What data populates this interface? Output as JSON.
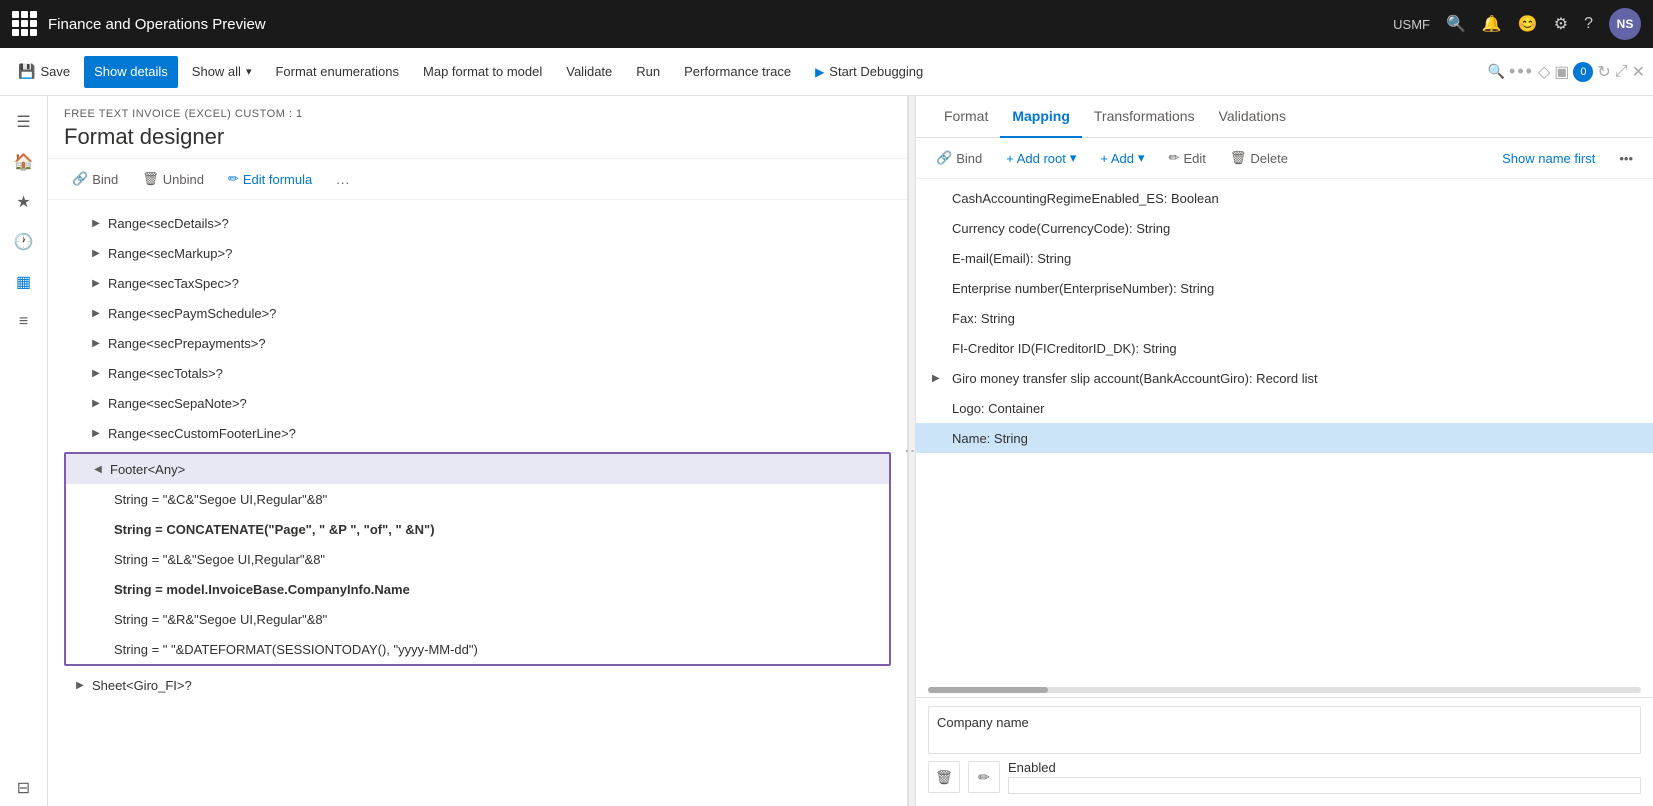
{
  "app": {
    "title": "Finance and Operations Preview",
    "user_region": "USMF",
    "avatar_initials": "NS"
  },
  "toolbar": {
    "save_label": "Save",
    "show_details_label": "Show details",
    "show_all_label": "Show all",
    "format_enumerations_label": "Format enumerations",
    "map_format_to_model_label": "Map format to model",
    "validate_label": "Validate",
    "run_label": "Run",
    "performance_trace_label": "Performance trace",
    "start_debugging_label": "Start Debugging"
  },
  "left_panel": {
    "breadcrumb": "FREE TEXT INVOICE (EXCEL) CUSTOM : 1",
    "page_title": "Format designer",
    "bind_label": "Bind",
    "unbind_label": "Unbind",
    "edit_formula_label": "Edit formula",
    "more_label": "...",
    "tree_items": [
      {
        "id": "range-secdetails",
        "label": "Range<secDetails>?",
        "indent": 1,
        "expanded": false
      },
      {
        "id": "range-secmarkup",
        "label": "Range<secMarkup>?",
        "indent": 1,
        "expanded": false
      },
      {
        "id": "range-sectaxspec",
        "label": "Range<secTaxSpec>?",
        "indent": 1,
        "expanded": false
      },
      {
        "id": "range-secpaymschedule",
        "label": "Range<secPaymSchedule>?",
        "indent": 1,
        "expanded": false
      },
      {
        "id": "range-secprepayments",
        "label": "Range<secPrepayments>?",
        "indent": 1,
        "expanded": false
      },
      {
        "id": "range-sectotals",
        "label": "Range<secTotals>?",
        "indent": 1,
        "expanded": false
      },
      {
        "id": "range-secsepanote",
        "label": "Range<secSepaNote>?",
        "indent": 1,
        "expanded": false
      },
      {
        "id": "range-seccustomfooterline",
        "label": "Range<secCustomFooterLine>?",
        "indent": 1,
        "expanded": false
      }
    ],
    "footer_group": {
      "header": "Footer<Any>",
      "items": [
        {
          "id": "string1",
          "label": "String = \"&C&\"Segoe UI,Regular\"&8\"",
          "bold": false
        },
        {
          "id": "string2",
          "label": "String = CONCATENATE(\"Page\", \" &P \", \"of\", \" &N\")",
          "bold": true
        },
        {
          "id": "string3",
          "label": "String = \"&L&\"Segoe UI,Regular\"&8\"",
          "bold": false
        },
        {
          "id": "string4",
          "label": "String = model.InvoiceBase.CompanyInfo.Name",
          "bold": true
        },
        {
          "id": "string5",
          "label": "String = \"&R&\"Segoe UI,Regular\"&8\"",
          "bold": false
        },
        {
          "id": "string6",
          "label": "String = \" \"&DATEFORMAT(SESSIONTODAY(), \"yyyy-MM-dd\")",
          "bold": false
        }
      ]
    },
    "sheet_item": "Sheet<Giro_FI>?"
  },
  "right_panel": {
    "tabs": [
      {
        "id": "format",
        "label": "Format",
        "active": false
      },
      {
        "id": "mapping",
        "label": "Mapping",
        "active": true
      },
      {
        "id": "transformations",
        "label": "Transformations",
        "active": false
      },
      {
        "id": "validations",
        "label": "Validations",
        "active": false
      }
    ],
    "bind_label": "Bind",
    "add_root_label": "+ Add root",
    "add_label": "+ Add",
    "edit_label": "Edit",
    "delete_label": "Delete",
    "show_name_first_label": "Show name first",
    "more_label": "...",
    "model_items": [
      {
        "id": "cash-accounting",
        "label": "CashAccountingRegimeEnabled_ES: Boolean",
        "indent": 0,
        "expandable": false
      },
      {
        "id": "currency-code",
        "label": "Currency code(CurrencyCode): String",
        "indent": 0,
        "expandable": false
      },
      {
        "id": "email",
        "label": "E-mail(Email): String",
        "indent": 0,
        "expandable": false
      },
      {
        "id": "enterprise-number",
        "label": "Enterprise number(EnterpriseNumber): String",
        "indent": 0,
        "expandable": false
      },
      {
        "id": "fax",
        "label": "Fax: String",
        "indent": 0,
        "expandable": false
      },
      {
        "id": "fi-creditor",
        "label": "FI-Creditor ID(FICreditorID_DK): String",
        "indent": 0,
        "expandable": false
      },
      {
        "id": "giro-money",
        "label": "Giro money transfer slip account(BankAccountGiro): Record list",
        "indent": 0,
        "expandable": true
      },
      {
        "id": "logo",
        "label": "Logo: Container",
        "indent": 0,
        "expandable": false
      },
      {
        "id": "name-string",
        "label": "Name: String",
        "indent": 0,
        "expandable": false,
        "selected": true
      }
    ],
    "bottom": {
      "company_name_label": "Company name",
      "enabled_label": "Enabled"
    }
  }
}
